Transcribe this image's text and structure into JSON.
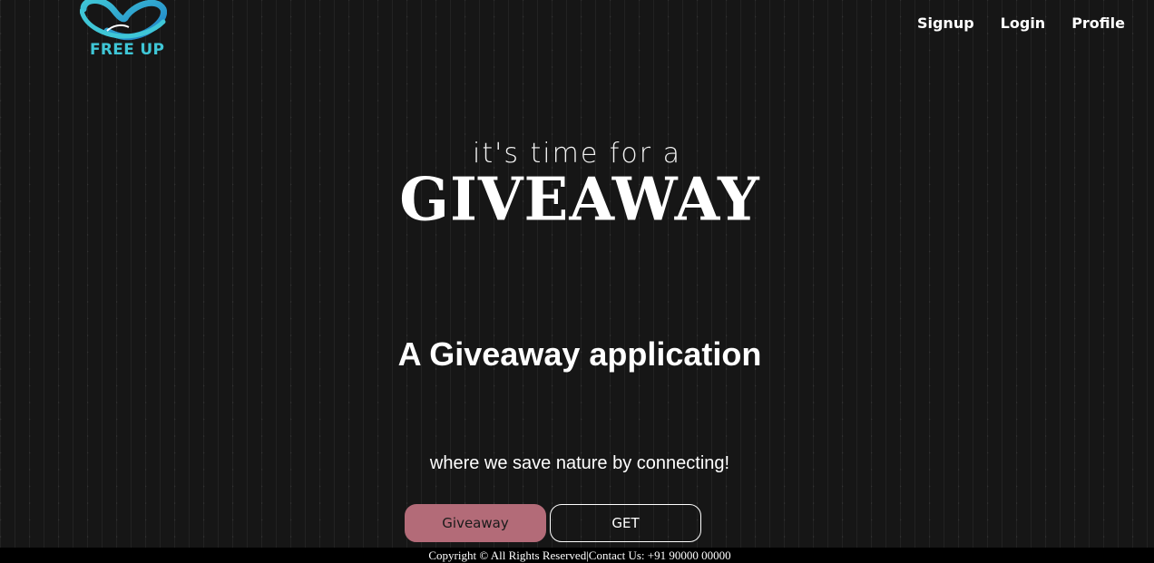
{
  "brand": {
    "name": "FREE UP",
    "logo_icon": "heart-hands-logo",
    "colors": {
      "accent": "#3fc6d6",
      "dark_accent": "#1e7fc7"
    }
  },
  "nav": {
    "items": [
      {
        "label": "Signup"
      },
      {
        "label": "Login"
      },
      {
        "label": "Profile"
      }
    ]
  },
  "hero": {
    "tagline": "it's time for a",
    "title": "GIVEAWAY",
    "heading": "A Giveaway application",
    "subheading": "where we save nature by connecting!"
  },
  "actions": {
    "giveaway_label": "Giveaway",
    "get_label": "GET",
    "colors": {
      "giveaway_bg": "#b36b78"
    }
  },
  "footer": {
    "text": "Copyright © All Rights Reserved|Contact Us: +91 90000 00000"
  }
}
